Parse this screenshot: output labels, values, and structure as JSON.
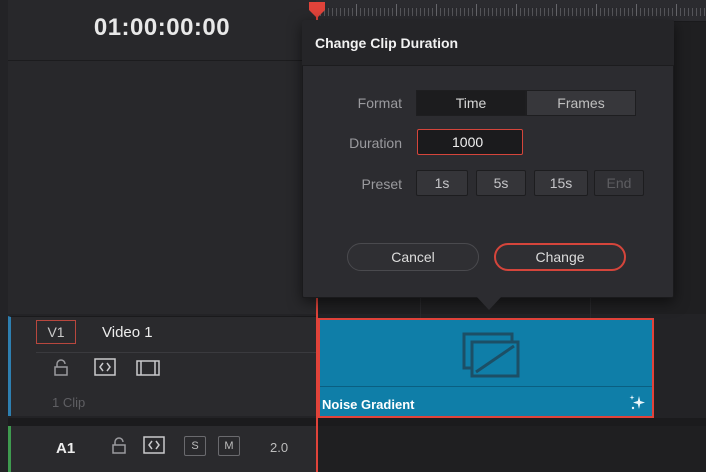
{
  "timeline": {
    "timecode": "01:00:00:00"
  },
  "dialog": {
    "title": "Change Clip Duration",
    "format_label": "Format",
    "format_options": [
      "Time",
      "Frames"
    ],
    "format_selected": "Time",
    "duration_label": "Duration",
    "duration_value": "1000",
    "preset_label": "Preset",
    "presets": [
      "1s",
      "5s",
      "15s",
      "End"
    ],
    "cancel_label": "Cancel",
    "change_label": "Change"
  },
  "video_track": {
    "id": "V1",
    "name": "Video 1",
    "clip_count": "1 Clip",
    "clip": {
      "name": "Noise Gradient",
      "color": "#0f7ea8"
    },
    "icons": [
      "lock-icon",
      "auto-select-icon",
      "film-icon"
    ]
  },
  "audio_track": {
    "id": "A1",
    "solo_label": "S",
    "mute_label": "M",
    "level": "2.0",
    "icons": [
      "lock-icon",
      "auto-select-icon"
    ]
  },
  "colors": {
    "accent": "#e0433a",
    "video_track": "#2e7fb0",
    "audio_track": "#3f9a4f"
  }
}
